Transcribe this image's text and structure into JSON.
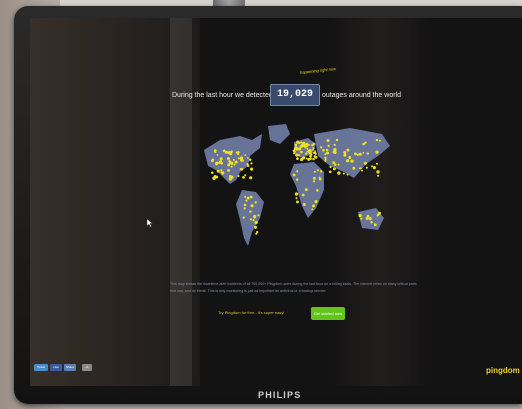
{
  "headline": {
    "prefix": "During the last hour we detected",
    "count": "19,029",
    "suffix": "outages around the world"
  },
  "annotation": "happening right now",
  "caption": "This map shows the downtime-alert incidents of all 700,000+ Pingdom users during the last hour on a rolling basis. The internet relies on many critical parts that can, and do break. This is why monitoring is just as important as antivirus or a backup service.",
  "cta": {
    "text": "Try Pingdom for free - it's super easy!",
    "button": "Get started now"
  },
  "brand": "pingdom",
  "monitor_brand": "PHILIPS",
  "share_buttons": [
    "Tweet",
    "Like",
    "Share",
    "+1"
  ],
  "colors": {
    "outage_dot": "#f0e020",
    "land": "#6c7aa0",
    "cta_button": "#62c41d",
    "brand": "#f2cf20"
  },
  "icons": [
    "cursor-arrow-icon"
  ]
}
